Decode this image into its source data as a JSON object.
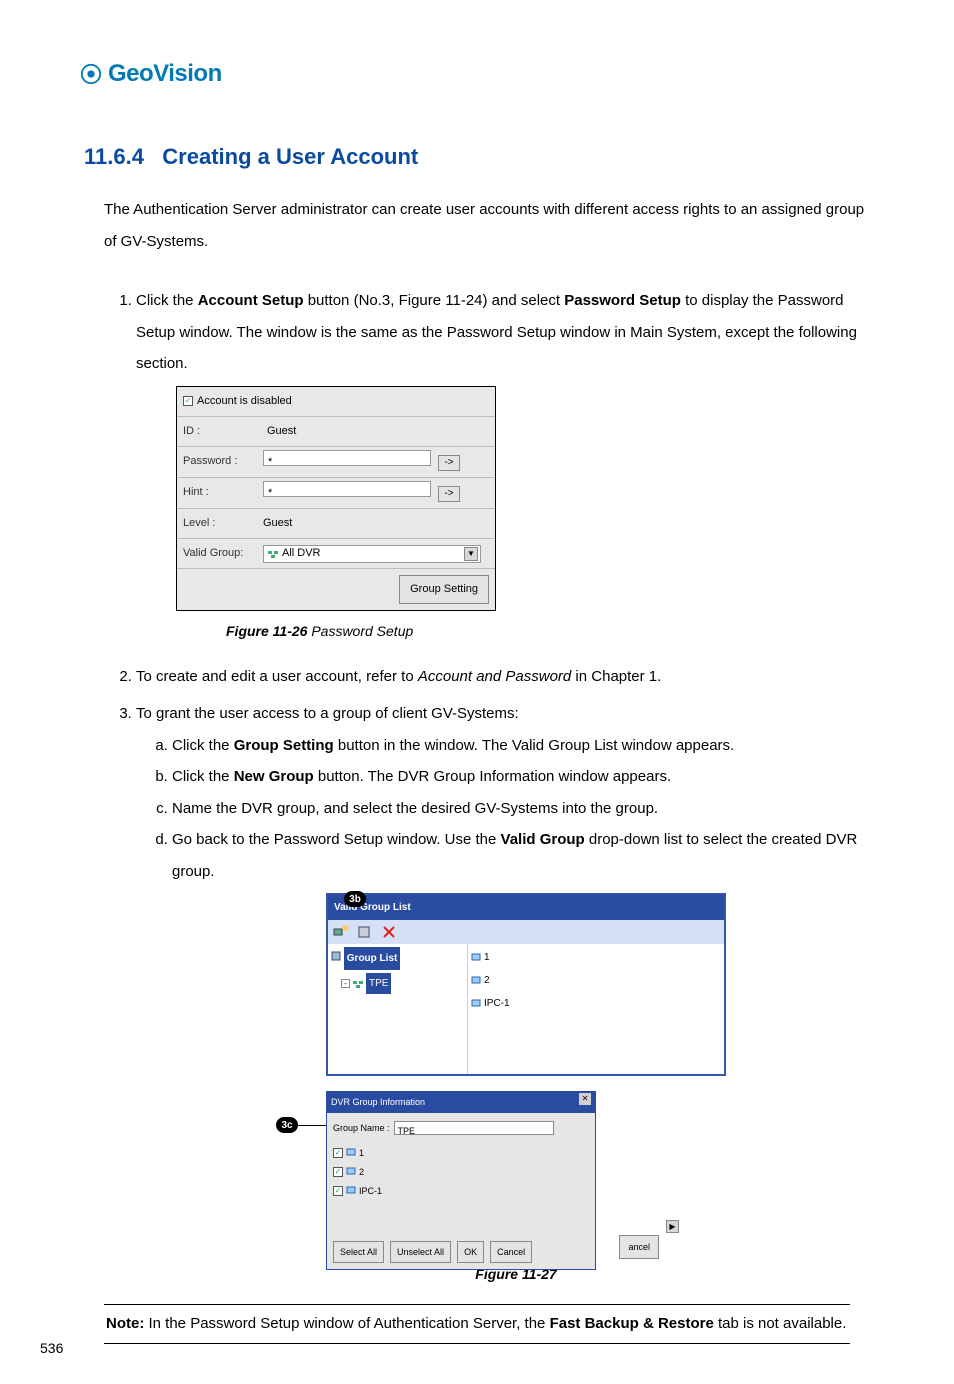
{
  "brand": "GeoVision",
  "section": {
    "number": "11.6.4",
    "title": "Creating a User Account"
  },
  "intro": "The Authentication Server administrator can create user accounts with different access rights to an assigned group of GV-Systems.",
  "step1": {
    "prefix": "Click the ",
    "bold1": "Account Setup",
    "mid": " button (No.3, Figure 11-24) and select ",
    "bold2": "Password Setup",
    "suffix": " to display the Password Setup window. The window is the same as the Password Setup window in Main System, except the following section."
  },
  "pwsetup": {
    "checkbox_label": "Account is disabled",
    "rows": {
      "id_label": "ID :",
      "id_value": "Guest",
      "password_label": "Password :",
      "password_value": "*",
      "hint_label": "Hint :",
      "hint_value": "*",
      "level_label": "Level :",
      "level_value": "Guest",
      "validgroup_label": "Valid Group:",
      "validgroup_value": "All DVR"
    },
    "expand_btn": "->",
    "group_setting_btn": "Group Setting"
  },
  "fig26": {
    "bold": "Figure 11-26",
    "rest": " Password Setup"
  },
  "step2": {
    "prefix": "To create and edit a user account, refer to ",
    "italic": "Account and Password",
    "suffix": " in Chapter 1."
  },
  "step3": {
    "line": "To grant the user access to a group of client GV-Systems:",
    "a": {
      "prefix": "Click the ",
      "bold": "Group Setting",
      "suffix": " button in the window. The Valid Group List window appears."
    },
    "b": {
      "prefix": "Click the ",
      "bold": "New Group",
      "suffix": " button. The DVR Group Information window appears."
    },
    "c": "Name the DVR group, and select the desired GV-Systems into the group.",
    "d": {
      "prefix": "Go back to the Password Setup window. Use the ",
      "bold": "Valid Group",
      "suffix": " drop-down list to select the created DVR group."
    }
  },
  "callouts": {
    "b3b": "3b",
    "b3c": "3c"
  },
  "vg": {
    "title": "Valid Group List",
    "tree_root": "Group List",
    "tree_item": "TPE",
    "list": [
      "1",
      "2",
      "IPC-1"
    ]
  },
  "dvr": {
    "title": "DVR Group Information",
    "groupname_label": "Group Name :",
    "groupname_value": "TPE",
    "items": [
      "1",
      "2",
      "IPC-1"
    ],
    "btn_selectall": "Select All",
    "btn_unselectall": "Unselect All",
    "btn_ok": "OK",
    "btn_cancel": "Cancel"
  },
  "cancel_right": "ancel",
  "fig27": "Figure 11-27",
  "note": {
    "bold1": "Note:",
    "mid": " In the Password Setup window of Authentication Server, the ",
    "bold2": "Fast Backup & Restore",
    "suffix": " tab is not available."
  },
  "page_number": "536"
}
